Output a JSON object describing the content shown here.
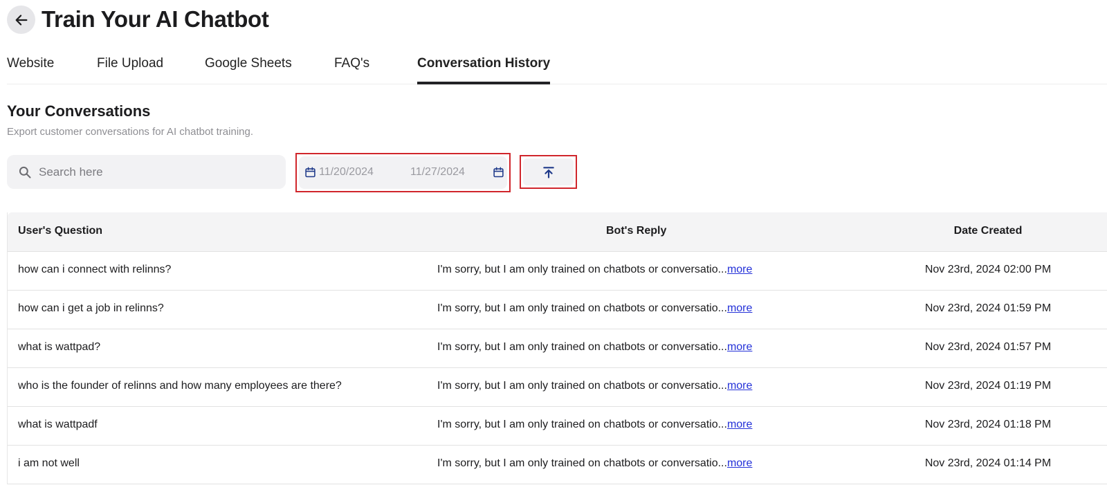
{
  "header": {
    "title": "Train Your AI Chatbot"
  },
  "tabs": [
    {
      "label": "Website",
      "active": false
    },
    {
      "label": "File Upload",
      "active": false
    },
    {
      "label": "Google Sheets",
      "active": false
    },
    {
      "label": "FAQ's",
      "active": false
    },
    {
      "label": "Conversation History",
      "active": true
    }
  ],
  "section": {
    "title": "Your Conversations",
    "subtitle": "Export customer conversations for AI chatbot training."
  },
  "search": {
    "placeholder": "Search here",
    "value": ""
  },
  "date_range": {
    "start": "11/20/2024",
    "end": "11/27/2024"
  },
  "table": {
    "headers": {
      "question": "User's Question",
      "reply": "Bot's Reply",
      "date": "Date Created"
    },
    "more_label": "more",
    "rows": [
      {
        "question": "how can i connect with relinns?",
        "reply": "I'm sorry, but I am only trained on chatbots or conversatio...",
        "date": "Nov 23rd, 2024 02:00 PM"
      },
      {
        "question": "how can i get a job in relinns?",
        "reply": "I'm sorry, but I am only trained on chatbots or conversatio...",
        "date": "Nov 23rd, 2024 01:59 PM"
      },
      {
        "question": "what is wattpad?",
        "reply": "I'm sorry, but I am only trained on chatbots or conversatio...",
        "date": "Nov 23rd, 2024 01:57 PM"
      },
      {
        "question": "who is the founder of relinns and how many employees are there?",
        "reply": "I'm sorry, but I am only trained on chatbots or conversatio...",
        "date": "Nov 23rd, 2024 01:19 PM"
      },
      {
        "question": "what is wattpadf",
        "reply": "I'm sorry, but I am only trained on chatbots or conversatio...",
        "date": "Nov 23rd, 2024 01:18 PM"
      },
      {
        "question": "i am not well",
        "reply": "I'm sorry, but I am only trained on chatbots or conversatio...",
        "date": "Nov 23rd, 2024 01:14 PM"
      }
    ]
  },
  "colors": {
    "highlight_border": "#d0252b",
    "link": "#2330d8",
    "icon_blue": "#1f3a8a"
  },
  "icons": {
    "back": "arrow-left-icon",
    "search": "search-icon",
    "calendar": "calendar-icon",
    "export": "upload-arrow-icon"
  }
}
